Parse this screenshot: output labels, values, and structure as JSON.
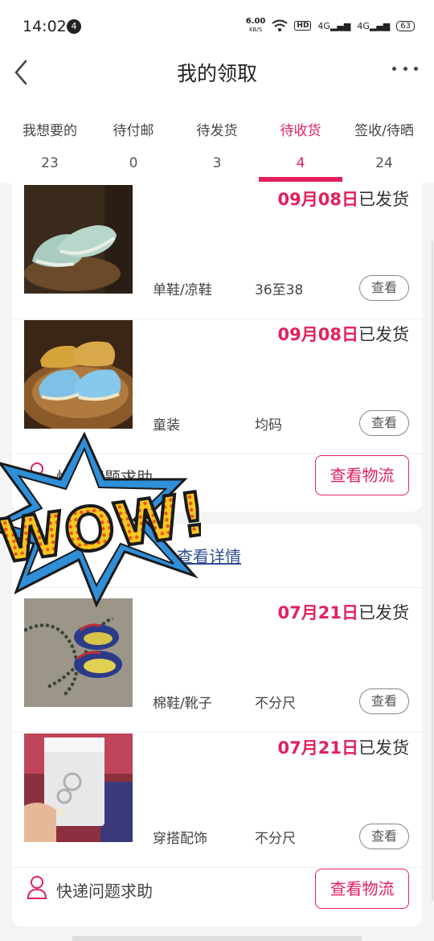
{
  "status": {
    "time": "14:02",
    "notification_count": "4",
    "speed_value": "6.00",
    "speed_unit": "KB/S",
    "hd": "HD",
    "net1": "4G",
    "net2": "4G",
    "battery": "63"
  },
  "header": {
    "title": "我的领取"
  },
  "tabs": [
    {
      "label": "我想要的",
      "count": "23"
    },
    {
      "label": "待付邮",
      "count": "0"
    },
    {
      "label": "待发货",
      "count": "3"
    },
    {
      "label": "待收货",
      "count": "4",
      "active": true
    },
    {
      "label": "签收/待晒",
      "count": "24"
    }
  ],
  "orders": [
    {
      "items": [
        {
          "date": "09月08日",
          "status": "已发货",
          "category": "单鞋/凉鞋",
          "size": "36至38",
          "view_label": "查看"
        },
        {
          "date": "09月08日",
          "status": "已发货",
          "category": "童装",
          "size": "均码",
          "view_label": "查看"
        }
      ],
      "help_label": "快递问题求助",
      "logistics_label": "查看物流"
    },
    {
      "details_label": "查看详情",
      "items": [
        {
          "date": "07月21日",
          "status": "已发货",
          "category": "棉鞋/靴子",
          "size": "不分尺",
          "view_label": "查看"
        },
        {
          "date": "07月21日",
          "status": "已发货",
          "category": "穿搭配饰",
          "size": "不分尺",
          "view_label": "查看"
        }
      ],
      "help_label": "快递问题求助",
      "logistics_label": "查看物流"
    }
  ],
  "overlay": {
    "text": "WOW!"
  },
  "colors": {
    "accent": "#e2215c",
    "link": "#2e4f8f"
  }
}
